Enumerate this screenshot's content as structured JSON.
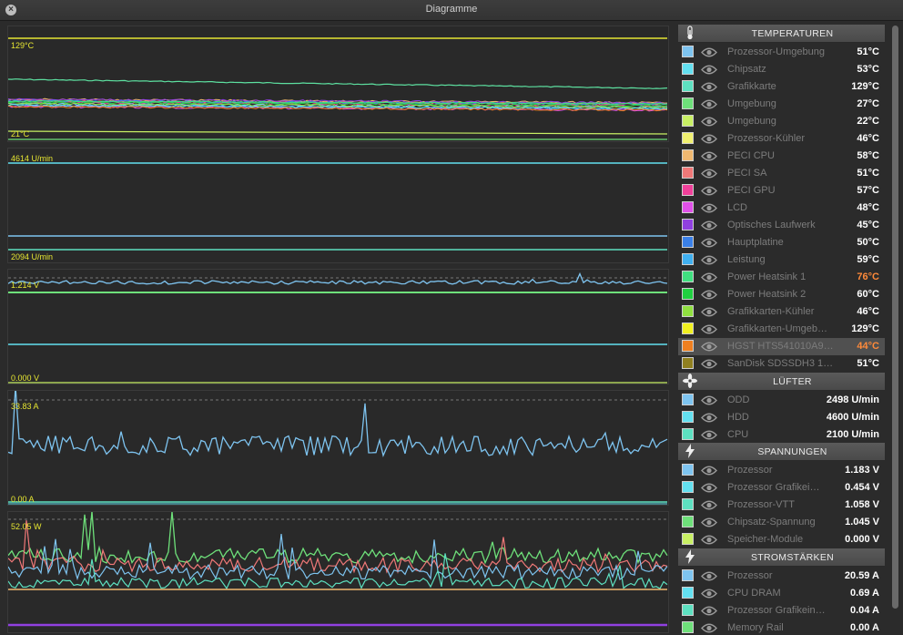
{
  "window": {
    "title": "Diagramme"
  },
  "charts": {
    "temperature": {
      "max_label": "129°C",
      "min_label": "21°C"
    },
    "fans": {
      "max_label": "4614 U/min",
      "min_label": "2094 U/min"
    },
    "voltage": {
      "max_label": "1.214 V",
      "min_label": "0.000 V"
    },
    "current": {
      "max_label": "33.83 A",
      "min_label": "0.00 A"
    },
    "power": {
      "max_label": "52.05 W"
    }
  },
  "sections": {
    "temperatures": {
      "title": "TEMPERATUREN",
      "icon": "thermometer-icon",
      "rows": [
        {
          "name": "Prozessor-Umgebung",
          "value": "51°C",
          "color": "#7ec4f0"
        },
        {
          "name": "Chipsatz",
          "value": "53°C",
          "color": "#63e0f0"
        },
        {
          "name": "Grafikkarte",
          "value": "129°C",
          "color": "#5de0c0"
        },
        {
          "name": "Umgebung",
          "value": "27°C",
          "color": "#6ee07a"
        },
        {
          "name": "Umgebung",
          "value": "22°C",
          "color": "#c8f064"
        },
        {
          "name": "Prozessor-Kühler",
          "value": "46°C",
          "color": "#f0f070"
        },
        {
          "name": "PECI CPU",
          "value": "58°C",
          "color": "#f0b870"
        },
        {
          "name": "PECI SA",
          "value": "51°C",
          "color": "#f07878"
        },
        {
          "name": "PECI GPU",
          "value": "57°C",
          "color": "#f0409a"
        },
        {
          "name": "LCD",
          "value": "48°C",
          "color": "#e050e8"
        },
        {
          "name": "Optisches Laufwerk",
          "value": "45°C",
          "color": "#9040e0"
        },
        {
          "name": "Hauptplatine",
          "value": "50°C",
          "color": "#3a80e8"
        },
        {
          "name": "Leistung",
          "value": "59°C",
          "color": "#40b0f0"
        },
        {
          "name": "Power Heatsink 1",
          "value": "76°C",
          "color": "#40e080",
          "warn": true
        },
        {
          "name": "Power Heatsink 2",
          "value": "60°C",
          "color": "#20d040"
        },
        {
          "name": "Grafikkarten-Kühler",
          "value": "46°C",
          "color": "#90e040"
        },
        {
          "name": "Grafikkarten-Umgeb…",
          "value": "129°C",
          "color": "#f0f020"
        },
        {
          "name": "HGST HTS541010A9…",
          "value": "44°C",
          "color": "#f08020",
          "warn": true,
          "highlight": true
        },
        {
          "name": "SanDisk SDSSDH3 1…",
          "value": "51°C",
          "color": "#908020"
        }
      ]
    },
    "fans": {
      "title": "LÜFTER",
      "icon": "fan-icon",
      "rows": [
        {
          "name": "ODD",
          "value": "2498 U/min",
          "color": "#7ec4f0"
        },
        {
          "name": "HDD",
          "value": "4600 U/min",
          "color": "#63e0f0"
        },
        {
          "name": "CPU",
          "value": "2100 U/min",
          "color": "#5de0c0"
        }
      ]
    },
    "voltages": {
      "title": "SPANNUNGEN",
      "icon": "lightning-icon",
      "rows": [
        {
          "name": "Prozessor",
          "value": "1.183 V",
          "color": "#7ec4f0"
        },
        {
          "name": "Prozessor Grafikei…",
          "value": "0.454 V",
          "color": "#63e0f0"
        },
        {
          "name": "Prozessor-VTT",
          "value": "1.058 V",
          "color": "#5de0c0"
        },
        {
          "name": "Chipsatz-Spannung",
          "value": "1.045 V",
          "color": "#6ee07a"
        },
        {
          "name": "Speicher-Module",
          "value": "0.000 V",
          "color": "#c8f064"
        }
      ]
    },
    "currents": {
      "title": "STROMSTÄRKEN",
      "icon": "lightning-icon",
      "rows": [
        {
          "name": "Prozessor",
          "value": "20.59 A",
          "color": "#7ec4f0"
        },
        {
          "name": "CPU DRAM",
          "value": "0.69 A",
          "color": "#63e0f0"
        },
        {
          "name": "Prozessor Grafikein…",
          "value": "0.04 A",
          "color": "#5de0c0"
        },
        {
          "name": "Memory Rail",
          "value": "0.00 A",
          "color": "#6ee07a"
        }
      ]
    }
  }
}
